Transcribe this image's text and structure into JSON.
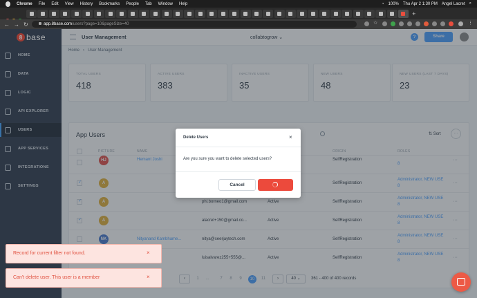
{
  "menubar": {
    "app": "Chrome",
    "items": [
      "File",
      "Edit",
      "View",
      "History",
      "Bookmarks",
      "People",
      "Tab",
      "Window",
      "Help"
    ],
    "battery": "100%",
    "datetime": "Thu Apr 2  1:30 PM",
    "user": "Angel Lacret"
  },
  "browser": {
    "url_host": "app.8base.com",
    "url_path": "/users?page=10&pageSize=40"
  },
  "sidebar": {
    "logo": "base",
    "logo_mark": "8",
    "items": [
      {
        "label": "HOME",
        "icon": "home-icon"
      },
      {
        "label": "DATA",
        "icon": "database-icon"
      },
      {
        "label": "LOGIC",
        "icon": "logic-icon"
      },
      {
        "label": "API EXPLORER",
        "icon": "api-explorer-icon"
      },
      {
        "label": "USERS",
        "icon": "users-icon"
      },
      {
        "label": "APP SERVICES",
        "icon": "app-services-icon"
      },
      {
        "label": "INTEGRATIONS",
        "icon": "integrations-icon"
      },
      {
        "label": "SETTINGS",
        "icon": "settings-icon"
      }
    ],
    "active_index": 4
  },
  "header": {
    "title": "User Management",
    "workspace": "collabtogrow ⌄",
    "help": "?",
    "share": "Share"
  },
  "breadcrumb": [
    "Home",
    "›",
    "User Management"
  ],
  "stats": [
    {
      "label": "TOTAL USERS",
      "value": "418"
    },
    {
      "label": "ACTIVE USERS",
      "value": "383"
    },
    {
      "label": "INACTIVE USERS",
      "value": "35"
    },
    {
      "label": "NEW USERS",
      "value": "48"
    },
    {
      "label": "NEW USERS (LAST 7 DAYS)",
      "value": "23"
    }
  ],
  "table": {
    "title": "App Users",
    "sort": "Sort",
    "more": "···",
    "columns": [
      "PICTURE",
      "NAME",
      "ORIGIN",
      "ROLES"
    ],
    "rows": [
      {
        "checked": false,
        "initials": "HJ",
        "color": "#e3534d",
        "name": "Hemant Joshi",
        "email": "",
        "status": "",
        "origin": "SelfRegistration",
        "roles": "8"
      },
      {
        "checked": true,
        "initials": "A",
        "color": "#e3b23c",
        "name": "",
        "email": "",
        "status": "",
        "origin": "SelfRegistration",
        "roles": "Administrator, NEW USE"
      },
      {
        "checked": true,
        "initials": "A",
        "color": "#e3b23c",
        "name": "",
        "email": "phi.borneo1@gmail.com",
        "status": "Active",
        "origin": "SelfRegistration",
        "roles": "Administrator, NEW USE"
      },
      {
        "checked": true,
        "initials": "A",
        "color": "#e3b23c",
        "name": "",
        "email": "alacret+150@gmail.co...",
        "status": "Active",
        "origin": "SelfRegistration",
        "roles": "Administrator, NEW USE"
      },
      {
        "checked": false,
        "initials": "NK",
        "color": "#4a7bd0",
        "name": "Nityanand Kambhame...",
        "email": "nitya@seerjaytech.com",
        "status": "Active",
        "origin": "SelfRegistration",
        "roles": "Administrator, NEW USE"
      },
      {
        "checked": false,
        "initials": "",
        "color": "#ffffff",
        "name": "",
        "email": "luisalvarez255+555@...",
        "status": "Active",
        "origin": "SelfRegistration",
        "roles": "Administrator, NEW USE"
      }
    ],
    "roles_suffix": "8"
  },
  "pagination": {
    "prev": "‹",
    "next": "›",
    "pages": [
      "1",
      "...",
      "7",
      "8",
      "9",
      "10",
      "11"
    ],
    "current": "10",
    "page_size": "40 ⌄",
    "range": "361 - 400 of 400 records"
  },
  "modal": {
    "title": "Delete Users",
    "close": "×",
    "body": "Are you sure you want to delete selected users?",
    "cancel": "Cancel"
  },
  "toasts": [
    {
      "message": "Record for current filter not found.",
      "close": "×"
    },
    {
      "message": "Can't delete user. This user is a member",
      "close": "×"
    }
  ],
  "colors": {
    "accent": "#4da1ff",
    "danger": "#ec4a3c",
    "sidebar": "#3b4859"
  }
}
